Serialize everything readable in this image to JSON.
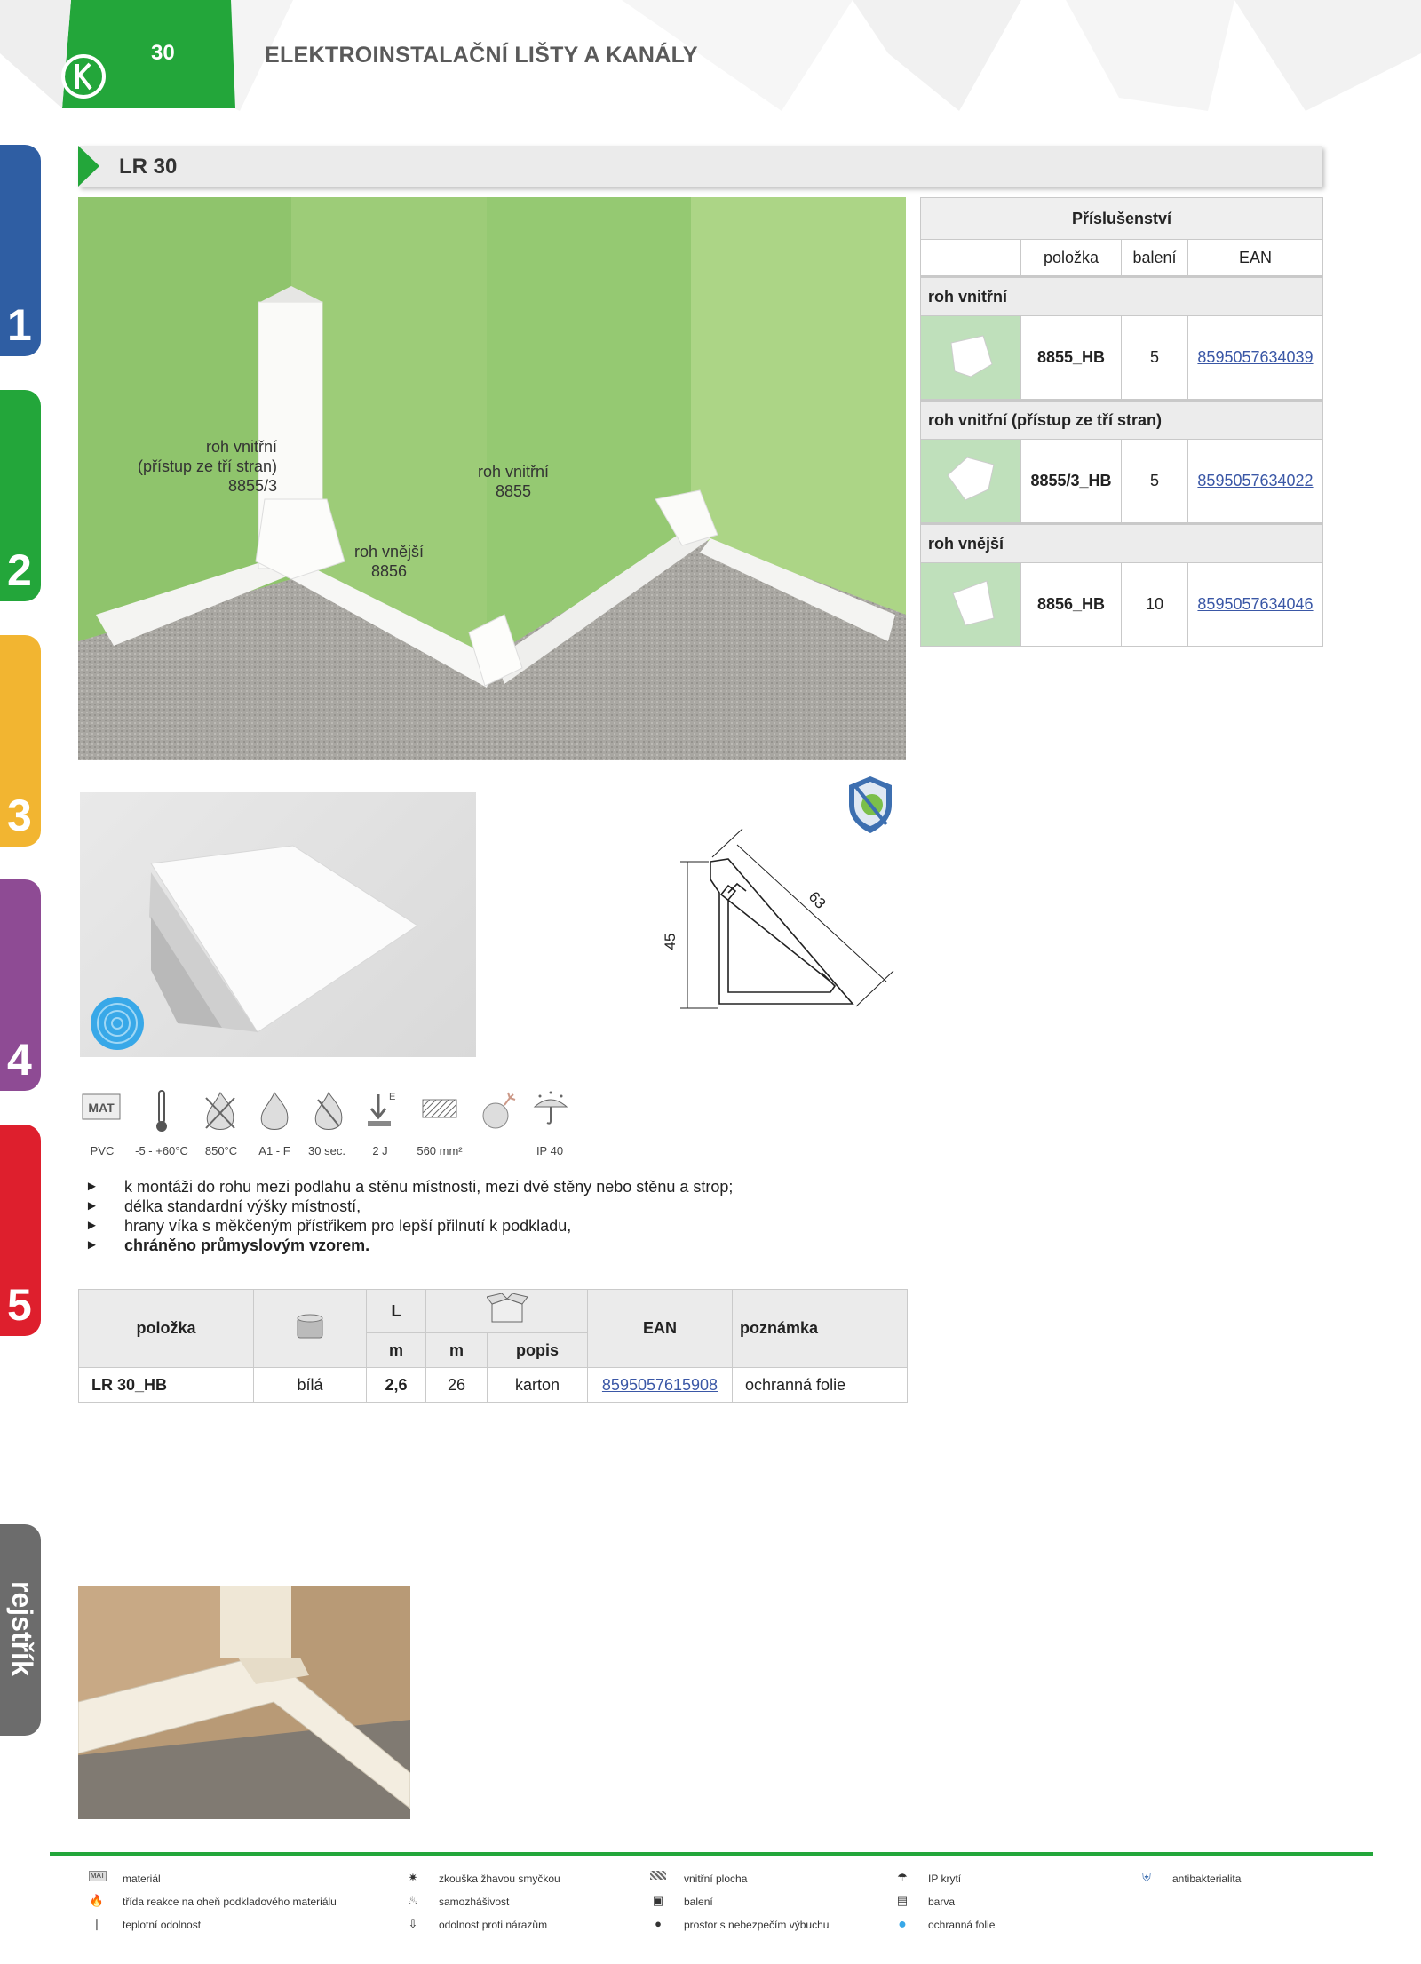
{
  "header": {
    "page_number": "30",
    "title": "ELEKTROINSTALAČNÍ LIŠTY A KANÁLY",
    "accent_color": "#23a63a"
  },
  "side_tabs": [
    {
      "label": "1",
      "color": "#2f5ea3"
    },
    {
      "label": "2",
      "color": "#23a63a"
    },
    {
      "label": "3",
      "color": "#f2b531"
    },
    {
      "label": "4",
      "color": "#8e4b94"
    },
    {
      "label": "5",
      "color": "#de1f2d"
    }
  ],
  "index_tab": {
    "label": "rejstřík",
    "color": "#6c6c6c"
  },
  "section": {
    "title": "LR 30"
  },
  "photo_labels": {
    "inner_3": {
      "line1": "roh vnitřní",
      "line2": "(přístup ze tří stran)",
      "line3": "8855/3"
    },
    "outer": {
      "line1": "roh vnější",
      "line2": "8856"
    },
    "inner": {
      "line1": "roh vnitřní",
      "line2": "8855"
    }
  },
  "accessories": {
    "title": "Příslušenství",
    "col_item": "položka",
    "col_pack": "balení",
    "col_ean": "EAN",
    "groups": [
      {
        "name": "roh vnitřní",
        "code": "8855_HB",
        "pack": "5",
        "ean": "8595057634039"
      },
      {
        "name": "roh vnitřní (přístup ze tří stran)",
        "code": "8855/3_HB",
        "pack": "5",
        "ean": "8595057634022"
      },
      {
        "name": "roh vnější",
        "code": "8856_HB",
        "pack": "10",
        "ean": "8595057634046"
      }
    ]
  },
  "drawing": {
    "height_label": "45",
    "width_label": "63"
  },
  "properties": [
    {
      "icon": "mat-icon",
      "caption": "PVC"
    },
    {
      "icon": "thermometer-icon",
      "caption": "-5 - +60°C"
    },
    {
      "icon": "glow-wire-icon",
      "caption": "850°C"
    },
    {
      "icon": "flame-icon",
      "caption": "A1 - F"
    },
    {
      "icon": "self-extinguish-icon",
      "caption": "30 sec."
    },
    {
      "icon": "impact-icon",
      "caption": "2 J"
    },
    {
      "icon": "area-icon",
      "caption": "560 mm²"
    },
    {
      "icon": "explosion-icon",
      "caption": ""
    },
    {
      "icon": "ip-icon",
      "caption": "IP 40"
    }
  ],
  "bullets": [
    "k montáži do rohu mezi podlahu a stěnu místnosti, mezi dvě stěny nebo stěnu a strop;",
    "délka standardní výšky místností,",
    "hrany víka s měkčeným přístřikem pro lepší přilnutí k podkladu,",
    "chráněno průmyslovým vzorem."
  ],
  "product_table": {
    "h_item": "položka",
    "h_L": "L",
    "h_m1": "m",
    "h_m2": "m",
    "h_popis": "popis",
    "h_ean": "EAN",
    "h_note": "poznámka",
    "row": {
      "item": "LR 30_HB",
      "color": "bílá",
      "L": "2,6",
      "m": "26",
      "popis": "karton",
      "ean": "8595057615908",
      "note": "ochranná folie"
    }
  },
  "legend": [
    {
      "icon": "mat-icon",
      "text": "materiál"
    },
    {
      "icon": "flame-icon",
      "text": "třída reakce na oheň podkladového materiálu"
    },
    {
      "icon": "thermometer-icon",
      "text": "teplotní odolnost"
    },
    {
      "icon": "glow-wire-icon",
      "text": "zkouška žhavou smyčkou"
    },
    {
      "icon": "self-extinguish-icon",
      "text": "samozhášivost"
    },
    {
      "icon": "impact-icon",
      "text": "odolnost proti nárazům"
    },
    {
      "icon": "area-icon",
      "text": "vnitřní plocha"
    },
    {
      "icon": "package-icon",
      "text": "balení"
    },
    {
      "icon": "explosion-icon",
      "text": "prostor s nebezpečím výbuchu"
    },
    {
      "icon": "ip-icon",
      "text": "IP krytí"
    },
    {
      "icon": "paint-icon",
      "text": "barva"
    },
    {
      "icon": "film-icon",
      "text": "ochranná folie"
    },
    {
      "icon": "shield-icon",
      "text": "antibakterialita"
    }
  ]
}
